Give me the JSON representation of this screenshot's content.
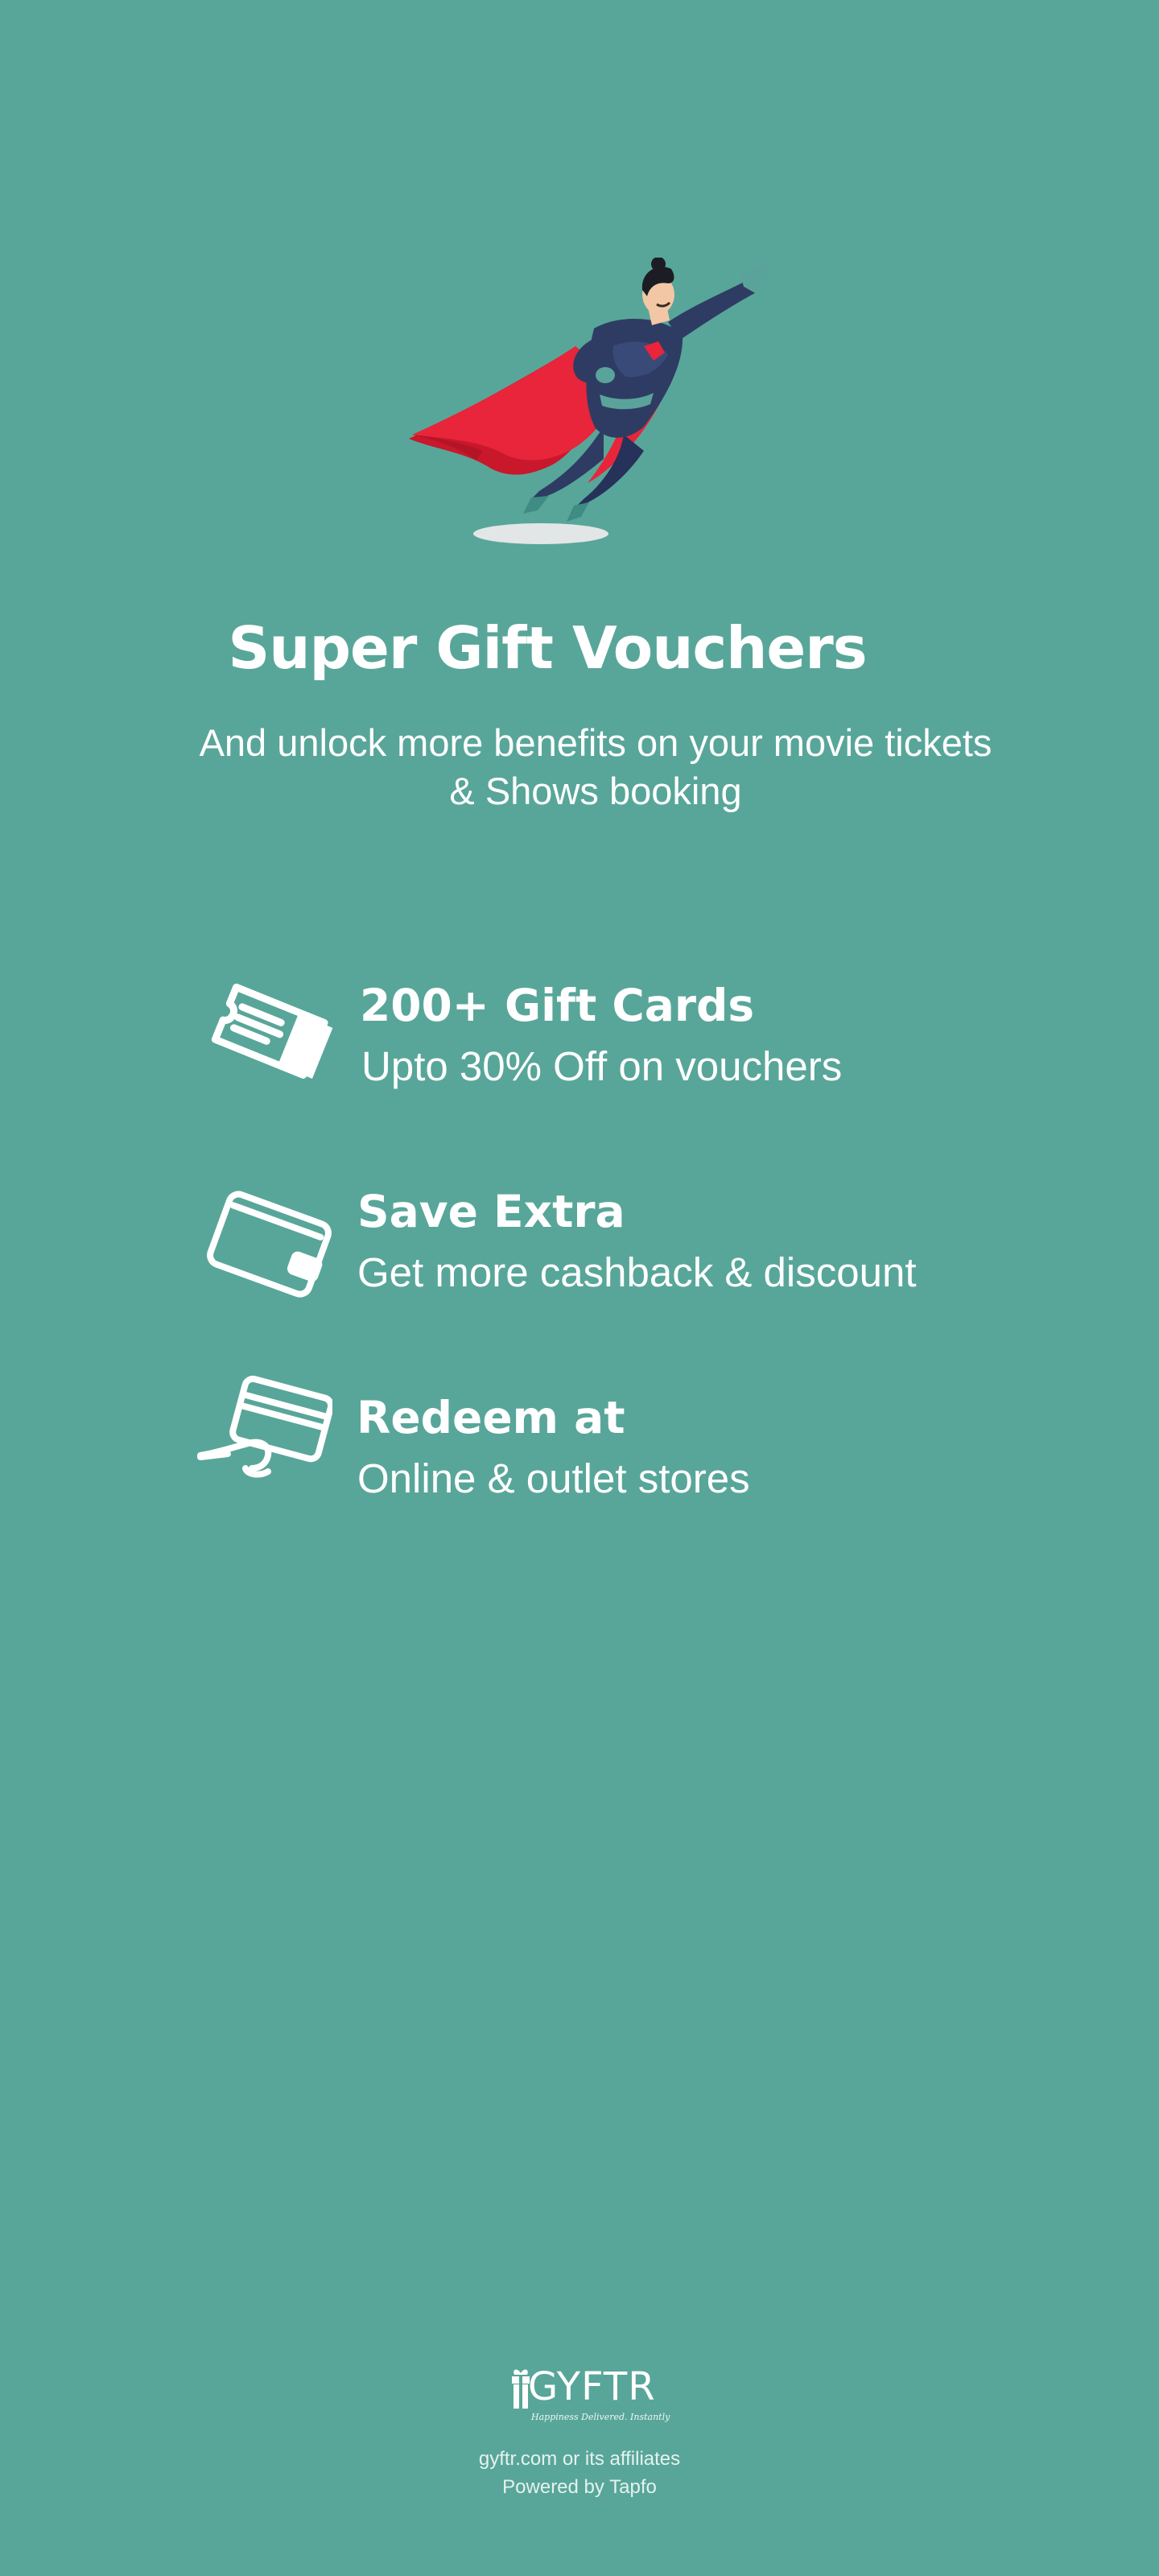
{
  "hero": {
    "title": "Super Gift Vouchers",
    "subtitle": "And unlock more benefits on your movie tickets & Shows booking"
  },
  "features": [
    {
      "icon": "ticket-icon",
      "title": "200+ Gift Cards",
      "description": "Upto 30% Off on vouchers"
    },
    {
      "icon": "wallet-icon",
      "title": "Save Extra",
      "description": "Get more cashback & discount"
    },
    {
      "icon": "card-in-hand-icon",
      "title": "Redeem at",
      "description": "Online & outlet stores"
    }
  ],
  "footer": {
    "brand": "GYFTR",
    "tagline": "Happiness Delivered. Instantly",
    "affiliates": "gyftr.com or its affiliates",
    "powered_by": "Powered by Tapfo"
  },
  "colors": {
    "background": "#58a699",
    "text": "#ffffff",
    "cape": "#e8253a",
    "suit": "#2e3c63"
  }
}
